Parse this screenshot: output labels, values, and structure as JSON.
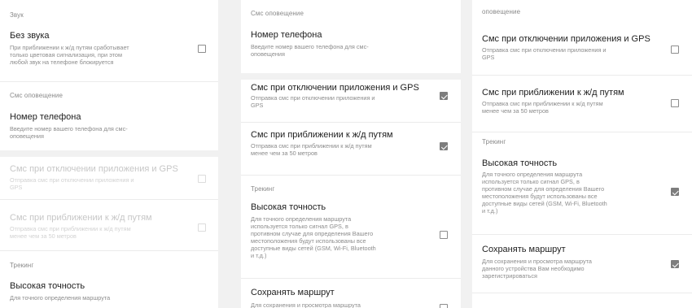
{
  "panel1": {
    "section_sound": "Звук",
    "silent_title": "Без звука",
    "silent_desc": "При приближении к ж/д путям сработывает\nтолько цветовая сигнализация, при этом\nлюбой звук на телефоне блокируется",
    "section_sms": "Смс оповещение",
    "phone_title": "Номер телефона",
    "phone_desc": "Введите номер вашего телефона для смс-\nоповещения",
    "sms_app_title": "Смс при отключении приложения и GPS",
    "sms_app_desc": "Отправка смс при отключении приложения и\nGPS",
    "sms_rail_title": "Смс при приближении к ж/д путям",
    "sms_rail_desc": "Отправка смс при приближении к ж/д путям\nменее чем за 50 метров",
    "section_tracking": "Трекинг",
    "accuracy_title": "Высокая точность",
    "accuracy_desc": "Для точного определения маршрута"
  },
  "panel2": {
    "section_sms": "Смс оповещение",
    "phone_title": "Номер телефона",
    "phone_desc": "Введите номер вашего телефона для смс-\nоповещения",
    "sms_app_title": "Смс при отключении приложения и GPS",
    "sms_app_desc": "Отправка смс при отключении приложения и\nGPS",
    "sms_rail_title": "Смс при приближении к ж/д путям",
    "sms_rail_desc": "Отправка смс при приближении к ж/д путям\nменее чем за 50 метров",
    "section_tracking": "Трекинг",
    "accuracy_title": "Высокая точность",
    "accuracy_desc": "Для точного определения маршрута\nиспользуется только сигнал GPS, в\nпротивном случае для определения Вашего\nместоположения будут использованы все\nдоступные виды сетей (GSM, Wi-Fi, Bluetooth\nи т.д.)",
    "save_title": "Сохранять маршрут",
    "save_desc": "Для сохранения и просмотра маршрута"
  },
  "panel3": {
    "section_sms": "оповещение",
    "sms_app_title": "Смс при отключении приложения и GPS",
    "sms_app_desc": "Отправка смс при отключении приложения и\nGPS",
    "sms_rail_title": "Смс при приближении к ж/д путям",
    "sms_rail_desc": "Отправка смс при приближении к ж/д путям\nменее чем за 50 метров",
    "section_tracking": "Трекинг",
    "accuracy_title": "Высокая точность",
    "accuracy_desc": "Для точного определения маршрута\nиспользуется только сигнал GPS, в\nпротивном случае для определения Вашего\nместоположения будут использованы все\nдоступные виды сетей (GSM, Wi-Fi, Bluetooth\nи т.д.)",
    "save_title": "Сохранять маршрут",
    "save_desc": "Для сохранения и просмотра маршрута\nданного устройства Вам необходимо\nзарегистрироваться"
  }
}
